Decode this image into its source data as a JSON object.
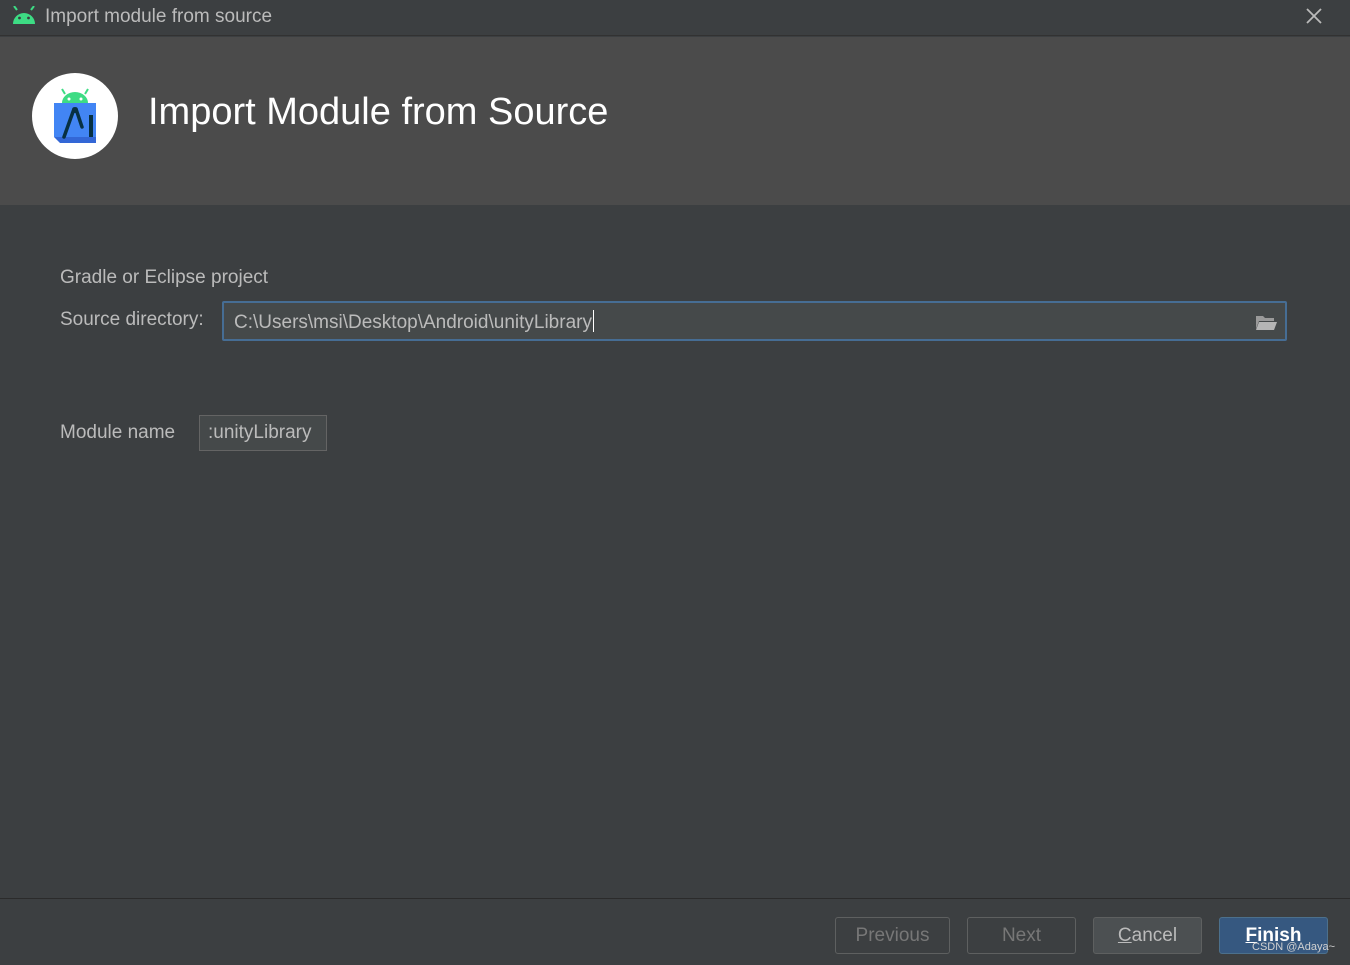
{
  "window": {
    "title": "Import module from source",
    "app_icon": "android-icon",
    "close_icon": "close-icon"
  },
  "banner": {
    "heading": "Import Module from Source",
    "logo": "android-studio-logo"
  },
  "form": {
    "project_type_label": "Gradle or Eclipse project",
    "source_directory_label": "Source directory:",
    "source_directory_value": "C:\\Users\\msi\\Desktop\\Android\\unityLibrary",
    "browse_icon": "folder-icon",
    "module_name_label": "Module name",
    "module_name_value": ":unityLibrary"
  },
  "footer": {
    "previous_label": "Previous",
    "next_label": "Next",
    "cancel_prefix": "C",
    "cancel_rest": "ancel",
    "finish_prefix": "F",
    "finish_rest": "inish"
  },
  "watermark": "CSDN @Adaya~",
  "colors": {
    "background": "#3c3f41",
    "banner": "#4b4b4b",
    "field_focus_border": "#466d94",
    "primary_button": "#365880",
    "android_green": "#3ddc84",
    "studio_blue": "#4285f4"
  }
}
